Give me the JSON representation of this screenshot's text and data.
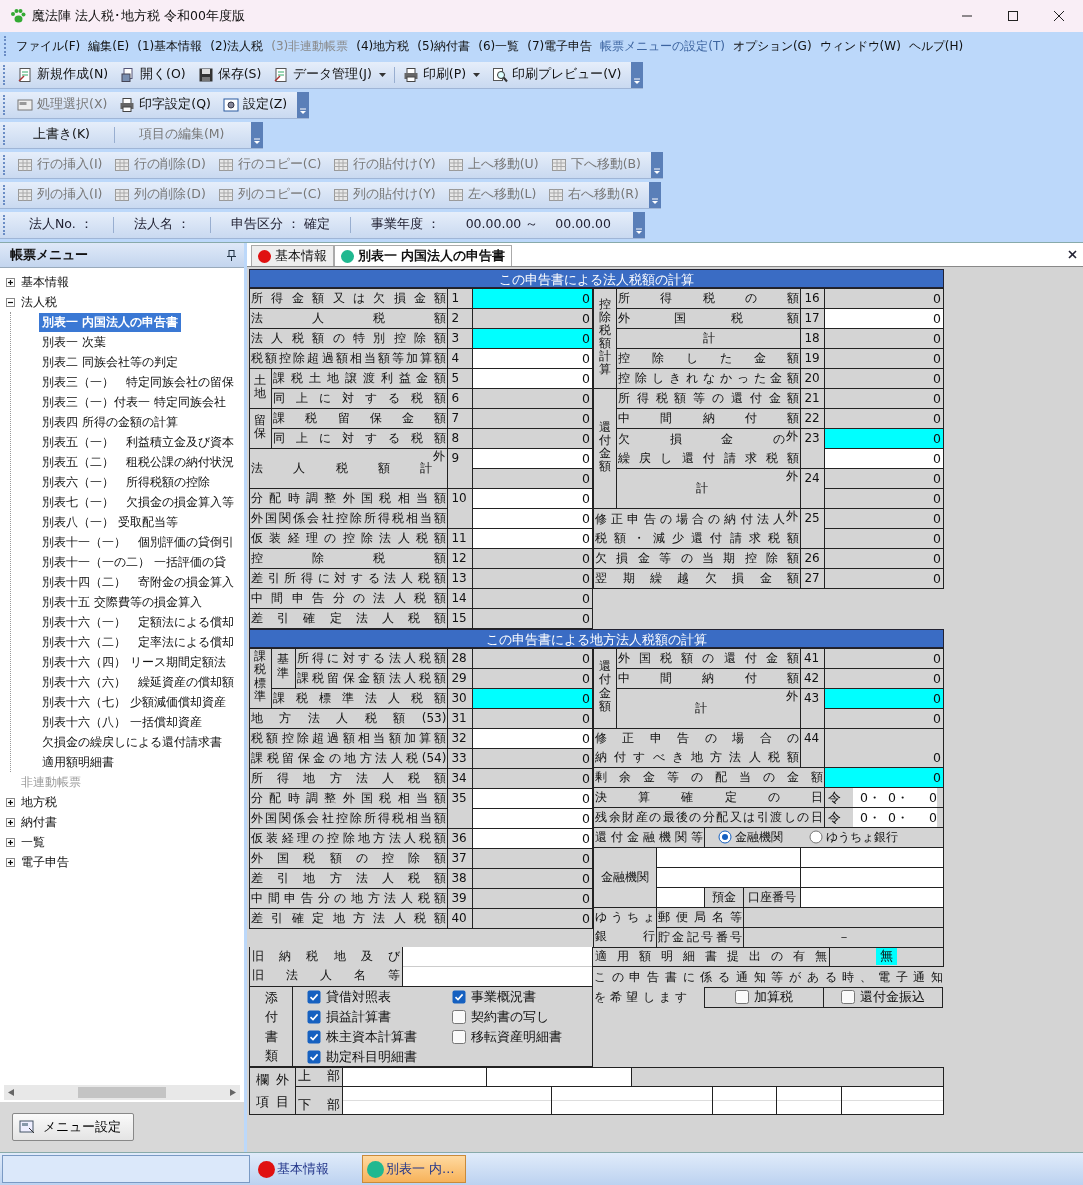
{
  "window": {
    "title": "魔法陣 法人税･地方税 令和00年度版"
  },
  "menu": [
    {
      "text": "ファイル(F)",
      "kind": "normal"
    },
    {
      "text": "編集(E)",
      "kind": "normal"
    },
    {
      "text": "(1)基本情報",
      "kind": "normal"
    },
    {
      "text": "(2)法人税",
      "kind": "normal"
    },
    {
      "text": "(3)非連動帳票",
      "kind": "disabled"
    },
    {
      "text": "(4)地方税",
      "kind": "normal"
    },
    {
      "text": "(5)納付書",
      "kind": "normal"
    },
    {
      "text": "(6)一覧",
      "kind": "normal"
    },
    {
      "text": "(7)電子申告",
      "kind": "normal"
    },
    {
      "text": "帳票メニューの設定(T)",
      "kind": "accent"
    },
    {
      "text": "オプション(G)",
      "kind": "normal"
    },
    {
      "text": "ウィンドウ(W)",
      "kind": "normal"
    },
    {
      "text": "ヘルプ(H)",
      "kind": "normal"
    }
  ],
  "toolbars": [
    {
      "kind": "buttons",
      "buttons": [
        {
          "text": "新規作成(N)",
          "disabled": false,
          "dropdown": false
        },
        {
          "text": "開く(O)",
          "disabled": false,
          "dropdown": false
        },
        {
          "text": "保存(S)",
          "disabled": false,
          "dropdown": false
        },
        {
          "text": "データ管理(J)",
          "disabled": false,
          "dropdown": true
        },
        {
          "text": "印刷(P)",
          "disabled": false,
          "dropdown": true
        },
        {
          "text": "印刷プレビュー(V)",
          "disabled": false,
          "dropdown": false
        }
      ]
    },
    {
      "kind": "buttons",
      "buttons": [
        {
          "text": "処理選択(X)",
          "disabled": true,
          "dropdown": false
        },
        {
          "text": "印字設定(Q)",
          "disabled": false,
          "dropdown": false
        },
        {
          "text": "設定(Z)",
          "disabled": false,
          "dropdown": false
        }
      ]
    },
    {
      "kind": "buttons",
      "buttons": [
        {
          "text": "上書き(K)",
          "disabled": false,
          "dropdown": false
        },
        {
          "text": "項目の編集(M)",
          "disabled": true,
          "dropdown": false
        }
      ]
    },
    {
      "kind": "buttons",
      "buttons": [
        {
          "text": "行の挿入(I)",
          "disabled": true,
          "dropdown": false
        },
        {
          "text": "行の削除(D)",
          "disabled": true,
          "dropdown": false
        },
        {
          "text": "行のコピー(C)",
          "disabled": true,
          "dropdown": false
        },
        {
          "text": "行の貼付け(Y)",
          "disabled": true,
          "dropdown": false
        },
        {
          "text": "上へ移動(U)",
          "disabled": true,
          "dropdown": false
        },
        {
          "text": "下へ移動(B)",
          "disabled": true,
          "dropdown": false
        }
      ]
    },
    {
      "kind": "buttons",
      "buttons": [
        {
          "text": "列の挿入(I)",
          "disabled": true,
          "dropdown": false
        },
        {
          "text": "列の削除(D)",
          "disabled": true,
          "dropdown": false
        },
        {
          "text": "列のコピー(C)",
          "disabled": true,
          "dropdown": false
        },
        {
          "text": "列の貼付け(Y)",
          "disabled": true,
          "dropdown": false
        },
        {
          "text": "左へ移動(L)",
          "disabled": true,
          "dropdown": false
        },
        {
          "text": "右へ移動(R)",
          "disabled": true,
          "dropdown": false
        }
      ]
    },
    {
      "kind": "info",
      "items": [
        "法人No. ：",
        "法人名 ：",
        "申告区分 ： 確定",
        "事業年度 ：　　00.00.00 ～　 00.00.00"
      ]
    }
  ],
  "sidebar": {
    "title": "帳票メニュー",
    "tree": [
      {
        "text": "基本情報",
        "expanded": false,
        "disabled": false
      },
      {
        "text": "法人税",
        "expanded": true,
        "disabled": false,
        "children": [
          {
            "text": "別表一 内国法人の申告書",
            "selected": true
          },
          {
            "text": "別表一 次葉",
            "selected": false
          },
          {
            "text": "別表二 同族会社等の判定",
            "selected": false
          },
          {
            "text": "別表三（一）　特定同族会社の留保",
            "selected": false
          },
          {
            "text": "別表三（一）付表一 特定同族会社",
            "selected": false
          },
          {
            "text": "別表四 所得の金額の計算",
            "selected": false
          },
          {
            "text": "別表五（一）　利益積立金及び資本",
            "selected": false
          },
          {
            "text": "別表五（二）　租税公課の納付状況",
            "selected": false
          },
          {
            "text": "別表六（一）　所得税額の控除",
            "selected": false
          },
          {
            "text": "別表七（一）　欠損金の損金算入等",
            "selected": false
          },
          {
            "text": "別表八（一） 受取配当等",
            "selected": false
          },
          {
            "text": "別表十一（一）　個別評価の貸倒引",
            "selected": false
          },
          {
            "text": "別表十一（一の二） 一括評価の貸",
            "selected": false
          },
          {
            "text": "別表十四（二）　寄附金の損金算入",
            "selected": false
          },
          {
            "text": "別表十五 交際費等の損金算入",
            "selected": false
          },
          {
            "text": "別表十六（一）　定額法による償却",
            "selected": false
          },
          {
            "text": "別表十六（二）　定率法による償却",
            "selected": false
          },
          {
            "text": "別表十六（四） リース期間定額法",
            "selected": false
          },
          {
            "text": "別表十六（六）　繰延資産の償却額",
            "selected": false
          },
          {
            "text": "別表十六（七） 少額減価償却資産",
            "selected": false
          },
          {
            "text": "別表十六（八） 一括償却資産",
            "selected": false
          },
          {
            "text": "欠損金の繰戻しによる還付請求書",
            "selected": false
          },
          {
            "text": "適用額明細書",
            "selected": false
          }
        ]
      },
      {
        "text": "非連動帳票",
        "disabled": true
      },
      {
        "text": "地方税",
        "expanded": false,
        "disabled": false
      },
      {
        "text": "納付書",
        "expanded": false,
        "disabled": false
      },
      {
        "text": "一覧",
        "expanded": false,
        "disabled": false
      },
      {
        "text": "電子申告",
        "expanded": false,
        "disabled": false
      }
    ],
    "button": "メニュー設定"
  },
  "tabs": [
    {
      "text": "基本情報",
      "selected": false,
      "color": "#e01010"
    },
    {
      "text": "別表一 内国法人の申告書",
      "selected": true,
      "color": "#20b890"
    }
  ],
  "form": {
    "sections": [
      {
        "title": "この申告書による法人税額の計算",
        "left": [
          [
            {
              "text": "所得金額又は欠損金額",
              "kind": "label",
              "colspan": 2
            },
            {
              "text": "1",
              "kind": "num"
            },
            {
              "text": "0",
              "kind": "hl"
            }
          ],
          [
            {
              "text": "法人税額",
              "kind": "label",
              "colspan": 2
            },
            {
              "text": "2",
              "kind": "num"
            },
            {
              "text": "0",
              "kind": "calc"
            }
          ],
          [
            {
              "text": "法人税額の特別控除額",
              "kind": "label",
              "colspan": 2
            },
            {
              "text": "3",
              "kind": "num"
            },
            {
              "text": "0",
              "kind": "hl"
            }
          ],
          [
            {
              "text": "税額控除超過額相当額等加算額",
              "kind": "label",
              "colspan": 2
            },
            {
              "text": "4",
              "kind": "num"
            },
            {
              "text": "0",
              "kind": "input"
            }
          ],
          [
            {
              "text": "土地",
              "kind": "vlabel",
              "rowspan": 2
            },
            {
              "text": "課税土地譲渡利益金額",
              "kind": "label"
            },
            {
              "text": "5",
              "kind": "num"
            },
            {
              "text": "0",
              "kind": "input"
            }
          ],
          [
            {
              "text": "同上に対する税額",
              "kind": "label"
            },
            {
              "text": "6",
              "kind": "num"
            },
            {
              "text": "0",
              "kind": "calc"
            }
          ],
          [
            {
              "text": "留保",
              "kind": "vlabel",
              "rowspan": 2
            },
            {
              "text": "課税留保金額",
              "kind": "label"
            },
            {
              "text": "7",
              "kind": "num"
            },
            {
              "text": "0",
              "kind": "calc"
            }
          ],
          [
            {
              "text": "同上に対する税額",
              "kind": "label"
            },
            {
              "text": "8",
              "kind": "num"
            },
            {
              "text": "0",
              "kind": "calc"
            }
          ],
          [
            {
              "text": "法人税額計",
              "kind": "label",
              "colspan": 2,
              "rowspan": 2,
              "corner": "外"
            },
            {
              "text": "9",
              "kind": "num",
              "rowspan": 2
            },
            {
              "text": "0",
              "kind": "input"
            }
          ],
          [
            {
              "text": "0",
              "kind": "calc"
            }
          ],
          [
            {
              "text": "分配時調整外国税相当額",
              "kind": "label",
              "colspan": 2
            },
            {
              "text": "10",
              "kind": "num",
              "rowspan": 2
            },
            {
              "text": "0",
              "kind": "input"
            }
          ],
          [
            {
              "text": "外国関係会社控除所得税相当額",
              "kind": "label",
              "colspan": 2
            },
            {
              "text": "0",
              "kind": "input"
            }
          ],
          [
            {
              "text": "仮装経理の控除法人税額",
              "kind": "label",
              "colspan": 2
            },
            {
              "text": "11",
              "kind": "num"
            },
            {
              "text": "0",
              "kind": "input"
            }
          ],
          [
            {
              "text": "控除税額",
              "kind": "label",
              "colspan": 2
            },
            {
              "text": "12",
              "kind": "num"
            },
            {
              "text": "0",
              "kind": "calc"
            }
          ],
          [
            {
              "text": "差引所得に対する法人税額",
              "kind": "label",
              "colspan": 2
            },
            {
              "text": "13",
              "kind": "num"
            },
            {
              "text": "0",
              "kind": "calc"
            }
          ],
          [
            {
              "text": "中間申告分の法人税額",
              "kind": "label",
              "colspan": 2
            },
            {
              "text": "14",
              "kind": "num"
            },
            {
              "text": "0",
              "kind": "calc"
            }
          ],
          [
            {
              "text": "差引確定法人税額",
              "kind": "label",
              "colspan": 2
            },
            {
              "text": "15",
              "kind": "num"
            },
            {
              "text": "0",
              "kind": "calc"
            }
          ]
        ],
        "right": [
          [
            {
              "text": "控除税額計算",
              "kind": "vlabel",
              "rowspan": 5
            },
            {
              "text": "所得税の額",
              "kind": "label"
            },
            {
              "text": "16",
              "kind": "num"
            },
            {
              "text": "0",
              "kind": "calc"
            }
          ],
          [
            {
              "text": "外国税額",
              "kind": "label"
            },
            {
              "text": "17",
              "kind": "num"
            },
            {
              "text": "0",
              "kind": "input"
            }
          ],
          [
            {
              "text": "計",
              "kind": "center"
            },
            {
              "text": "18",
              "kind": "num"
            },
            {
              "text": "0",
              "kind": "calc"
            }
          ],
          [
            {
              "text": "控除した金額",
              "kind": "label"
            },
            {
              "text": "19",
              "kind": "num"
            },
            {
              "text": "0",
              "kind": "calc"
            }
          ],
          [
            {
              "text": "控除しきれなかった金額",
              "kind": "label"
            },
            {
              "text": "20",
              "kind": "num"
            },
            {
              "text": "0",
              "kind": "calc"
            }
          ],
          [
            {
              "text": "還付金額",
              "kind": "vlabel",
              "rowspan": 6
            },
            {
              "text": "所得税額等の還付金額",
              "kind": "label"
            },
            {
              "text": "21",
              "kind": "num"
            },
            {
              "text": "0",
              "kind": "calc"
            }
          ],
          [
            {
              "text": "中間納付額",
              "kind": "label"
            },
            {
              "text": "22",
              "kind": "num"
            },
            {
              "text": "0",
              "kind": "calc"
            }
          ],
          [
            {
              "lines": [
                "欠損金の",
                "繰戻し還付請求税額"
              ],
              "kind": "label",
              "rowspan": 2,
              "corner": "外"
            },
            {
              "text": "23",
              "kind": "num",
              "rowspan": 2
            },
            {
              "text": "0",
              "kind": "hl"
            }
          ],
          [
            {
              "text": "0",
              "kind": "input"
            }
          ],
          [
            {
              "text": "計",
              "kind": "center",
              "rowspan": 2,
              "corner": "外"
            },
            {
              "text": "24",
              "kind": "num",
              "rowspan": 2
            },
            {
              "text": "0",
              "kind": "calc"
            }
          ],
          [
            {
              "text": "0",
              "kind": "calc"
            }
          ],
          [
            {
              "lines": [
                "修正申告の場合の納付法人",
                "税額・減少還付請求税額"
              ],
              "kind": "label",
              "colspan": 2,
              "rowspan": 2,
              "corner": "外"
            },
            {
              "text": "25",
              "kind": "num",
              "rowspan": 2
            },
            {
              "text": "0",
              "kind": "calc"
            }
          ],
          [
            {
              "text": "0",
              "kind": "calc"
            }
          ],
          [
            {
              "text": "欠損金等の当期控除額",
              "kind": "label",
              "colspan": 2
            },
            {
              "text": "26",
              "kind": "num"
            },
            {
              "text": "0",
              "kind": "calc"
            }
          ],
          [
            {
              "text": "翌期繰越欠損金額",
              "kind": "label",
              "colspan": 2
            },
            {
              "text": "27",
              "kind": "num"
            },
            {
              "text": "0",
              "kind": "calc"
            }
          ]
        ]
      },
      {
        "title": "この申告書による地方法人税額の計算",
        "left": [
          [
            {
              "text": "課税標準",
              "kind": "vlabel",
              "rowspan": 3
            },
            {
              "text": "基準",
              "kind": "vlabel",
              "rowspan": 2
            },
            {
              "text": "所得に対する法人税額",
              "kind": "label"
            },
            {
              "text": "28",
              "kind": "num"
            },
            {
              "text": "0",
              "kind": "calc"
            }
          ],
          [
            {
              "text": "課税留保金額法人税額",
              "kind": "label"
            },
            {
              "text": "29",
              "kind": "num"
            },
            {
              "text": "0",
              "kind": "calc"
            }
          ],
          [
            {
              "text": "課税標準法人税額",
              "kind": "label",
              "colspan": 2
            },
            {
              "text": "30",
              "kind": "num"
            },
            {
              "text": "0",
              "kind": "hl"
            }
          ],
          [
            {
              "text": "地方法人税額(53)",
              "kind": "label",
              "colspan": 3
            },
            {
              "text": "31",
              "kind": "num"
            },
            {
              "text": "0",
              "kind": "calc"
            }
          ],
          [
            {
              "text": "税額控除超過額相当額加算額",
              "kind": "label",
              "colspan": 3
            },
            {
              "text": "32",
              "kind": "num"
            },
            {
              "text": "0",
              "kind": "input"
            }
          ],
          [
            {
              "text": "課税留保金の地方法人税(54)",
              "kind": "label",
              "colspan": 3
            },
            {
              "text": "33",
              "kind": "num"
            },
            {
              "text": "0",
              "kind": "calc"
            }
          ],
          [
            {
              "text": "所得地方法人税額",
              "kind": "label",
              "colspan": 3
            },
            {
              "text": "34",
              "kind": "num"
            },
            {
              "text": "0",
              "kind": "calc"
            }
          ],
          [
            {
              "text": "分配時調整外国税相当額",
              "kind": "label",
              "colspan": 3
            },
            {
              "text": "35",
              "kind": "num",
              "rowspan": 2
            },
            {
              "text": "0",
              "kind": "input"
            }
          ],
          [
            {
              "text": "外国関係会社控除所得税相当額",
              "kind": "label",
              "colspan": 3
            },
            {
              "text": "0",
              "kind": "input"
            }
          ],
          [
            {
              "text": "仮装経理の控除地方法人税額",
              "kind": "label",
              "colspan": 3
            },
            {
              "text": "36",
              "kind": "num"
            },
            {
              "text": "0",
              "kind": "input"
            }
          ],
          [
            {
              "text": "外国税額の控除額",
              "kind": "label",
              "colspan": 3
            },
            {
              "text": "37",
              "kind": "num"
            },
            {
              "text": "0",
              "kind": "calc"
            }
          ],
          [
            {
              "text": "差引地方法人税額",
              "kind": "label",
              "colspan": 3
            },
            {
              "text": "38",
              "kind": "num"
            },
            {
              "text": "0",
              "kind": "calc"
            }
          ],
          [
            {
              "text": "中間申告分の地方法人税額",
              "kind": "label",
              "colspan": 3
            },
            {
              "text": "39",
              "kind": "num"
            },
            {
              "text": "0",
              "kind": "calc"
            }
          ],
          [
            {
              "text": "差引確定地方法人税額",
              "kind": "label",
              "colspan": 3,
              "rowspan": 2
            },
            {
              "text": "40",
              "kind": "num",
              "rowspan": 2
            },
            {
              "text": "0",
              "kind": "calc",
              "rowspan": 2
            }
          ]
        ],
        "right": [
          [
            {
              "text": "還付金額",
              "kind": "vlabel",
              "rowspan": 4
            },
            {
              "text": "外国税額の還付金額",
              "kind": "label",
              "colspan": 4
            },
            {
              "text": "41",
              "kind": "num"
            },
            {
              "text": "0",
              "kind": "calc"
            }
          ],
          [
            {
              "text": "中間納付額",
              "kind": "label",
              "colspan": 4
            },
            {
              "text": "42",
              "kind": "num"
            },
            {
              "text": "0",
              "kind": "calc"
            }
          ],
          [
            {
              "text": "計",
              "kind": "center",
              "colspan": 4,
              "rowspan": 2,
              "corner": "外"
            },
            {
              "text": "43",
              "kind": "num",
              "rowspan": 2
            },
            {
              "text": "0",
              "kind": "hl"
            }
          ],
          [
            {
              "text": "0",
              "kind": "calc"
            }
          ],
          [
            {
              "lines": [
                "修正申告の場合の",
                "納付すべき地方法人税額"
              ],
              "kind": "label",
              "colspan": 5
            },
            {
              "text": "44",
              "kind": "num"
            },
            {
              "text": "0",
              "kind": "calc"
            }
          ],
          [
            {
              "text": "剰余金等の配当の金額",
              "kind": "label",
              "colspan": 6
            },
            {
              "text": "0",
              "kind": "hl"
            }
          ],
          [
            {
              "text": "決算確定の日",
              "kind": "label",
              "colspan": 6
            },
            {
              "kind": "date",
              "era": "令",
              "parts": [
                "0・",
                "0・",
                "0"
              ]
            }
          ],
          [
            {
              "text": "残余財産の最後の分配又は引渡しの日",
              "kind": "label",
              "colspan": 6
            },
            {
              "kind": "date",
              "era": "令",
              "parts": [
                "0・",
                "0・",
                "0"
              ]
            }
          ],
          [
            {
              "text": "還付金融機関等",
              "kind": "label",
              "colspan": 3
            },
            {
              "kind": "radios",
              "colspan": 4,
              "options": [
                {
                  "text": "金融機関",
                  "selected": true
                },
                {
                  "text": "ゆうちょ銀行",
                  "selected": false
                }
              ]
            }
          ],
          [
            {
              "text": "金融機関",
              "kind": "center",
              "colspan": 2,
              "rowspan": 3
            },
            {
              "kind": "field",
              "colspan": 3
            },
            {
              "kind": "field",
              "colspan": 2
            }
          ],
          [
            {
              "kind": "field",
              "colspan": 3
            },
            {
              "kind": "field",
              "colspan": 2
            }
          ],
          [
            {
              "kind": "field"
            },
            {
              "text": "預金",
              "kind": "center"
            },
            {
              "text": "口座番号",
              "kind": "center"
            },
            {
              "kind": "field",
              "colspan": 2
            }
          ],
          [
            {
              "lines": [
                "ゆうちょ",
                "銀行"
              ],
              "kind": "label",
              "colspan": 2,
              "rowspan": 2
            },
            {
              "text": "郵便局名等",
              "kind": "label",
              "colspan": 2
            },
            {
              "kind": "blank",
              "colspan": 3
            }
          ],
          [
            {
              "text": "貯金記号番号",
              "kind": "label",
              "colspan": 2
            },
            {
              "text": "－",
              "kind": "center",
              "colspan": 3
            }
          ]
        ]
      }
    ],
    "former": [
      "旧納税地及び",
      "旧法人名等"
    ],
    "attachments": {
      "label": "添付書類",
      "items": [
        {
          "text": "貸借対照表",
          "checked": true
        },
        {
          "text": "損益計算書",
          "checked": true
        },
        {
          "text": "株主資本計算書",
          "checked": true
        },
        {
          "text": "勘定科目明細書",
          "checked": true
        },
        {
          "text": "事業概況書",
          "checked": true
        },
        {
          "text": "契約書の写し",
          "checked": false
        },
        {
          "text": "移転資産明細書",
          "checked": false
        }
      ]
    },
    "detail_statement": {
      "label": "適用額明細書提出の有無",
      "value": "無"
    },
    "e_notice": {
      "lines": [
        "この申告書に係る通知等がある時、電子通知",
        "を希望します"
      ],
      "options": [
        {
          "text": "加算税",
          "checked": false
        },
        {
          "text": "還付金振込",
          "checked": false
        }
      ]
    },
    "margin_items": {
      "label": "欄外項目",
      "rows": [
        "上部",
        "下部"
      ]
    }
  },
  "taskbar": [
    {
      "text": "基本情報",
      "selected": false,
      "color": "#e01010"
    },
    {
      "text": "別表一 内…",
      "selected": true,
      "color": "#20b890"
    }
  ]
}
